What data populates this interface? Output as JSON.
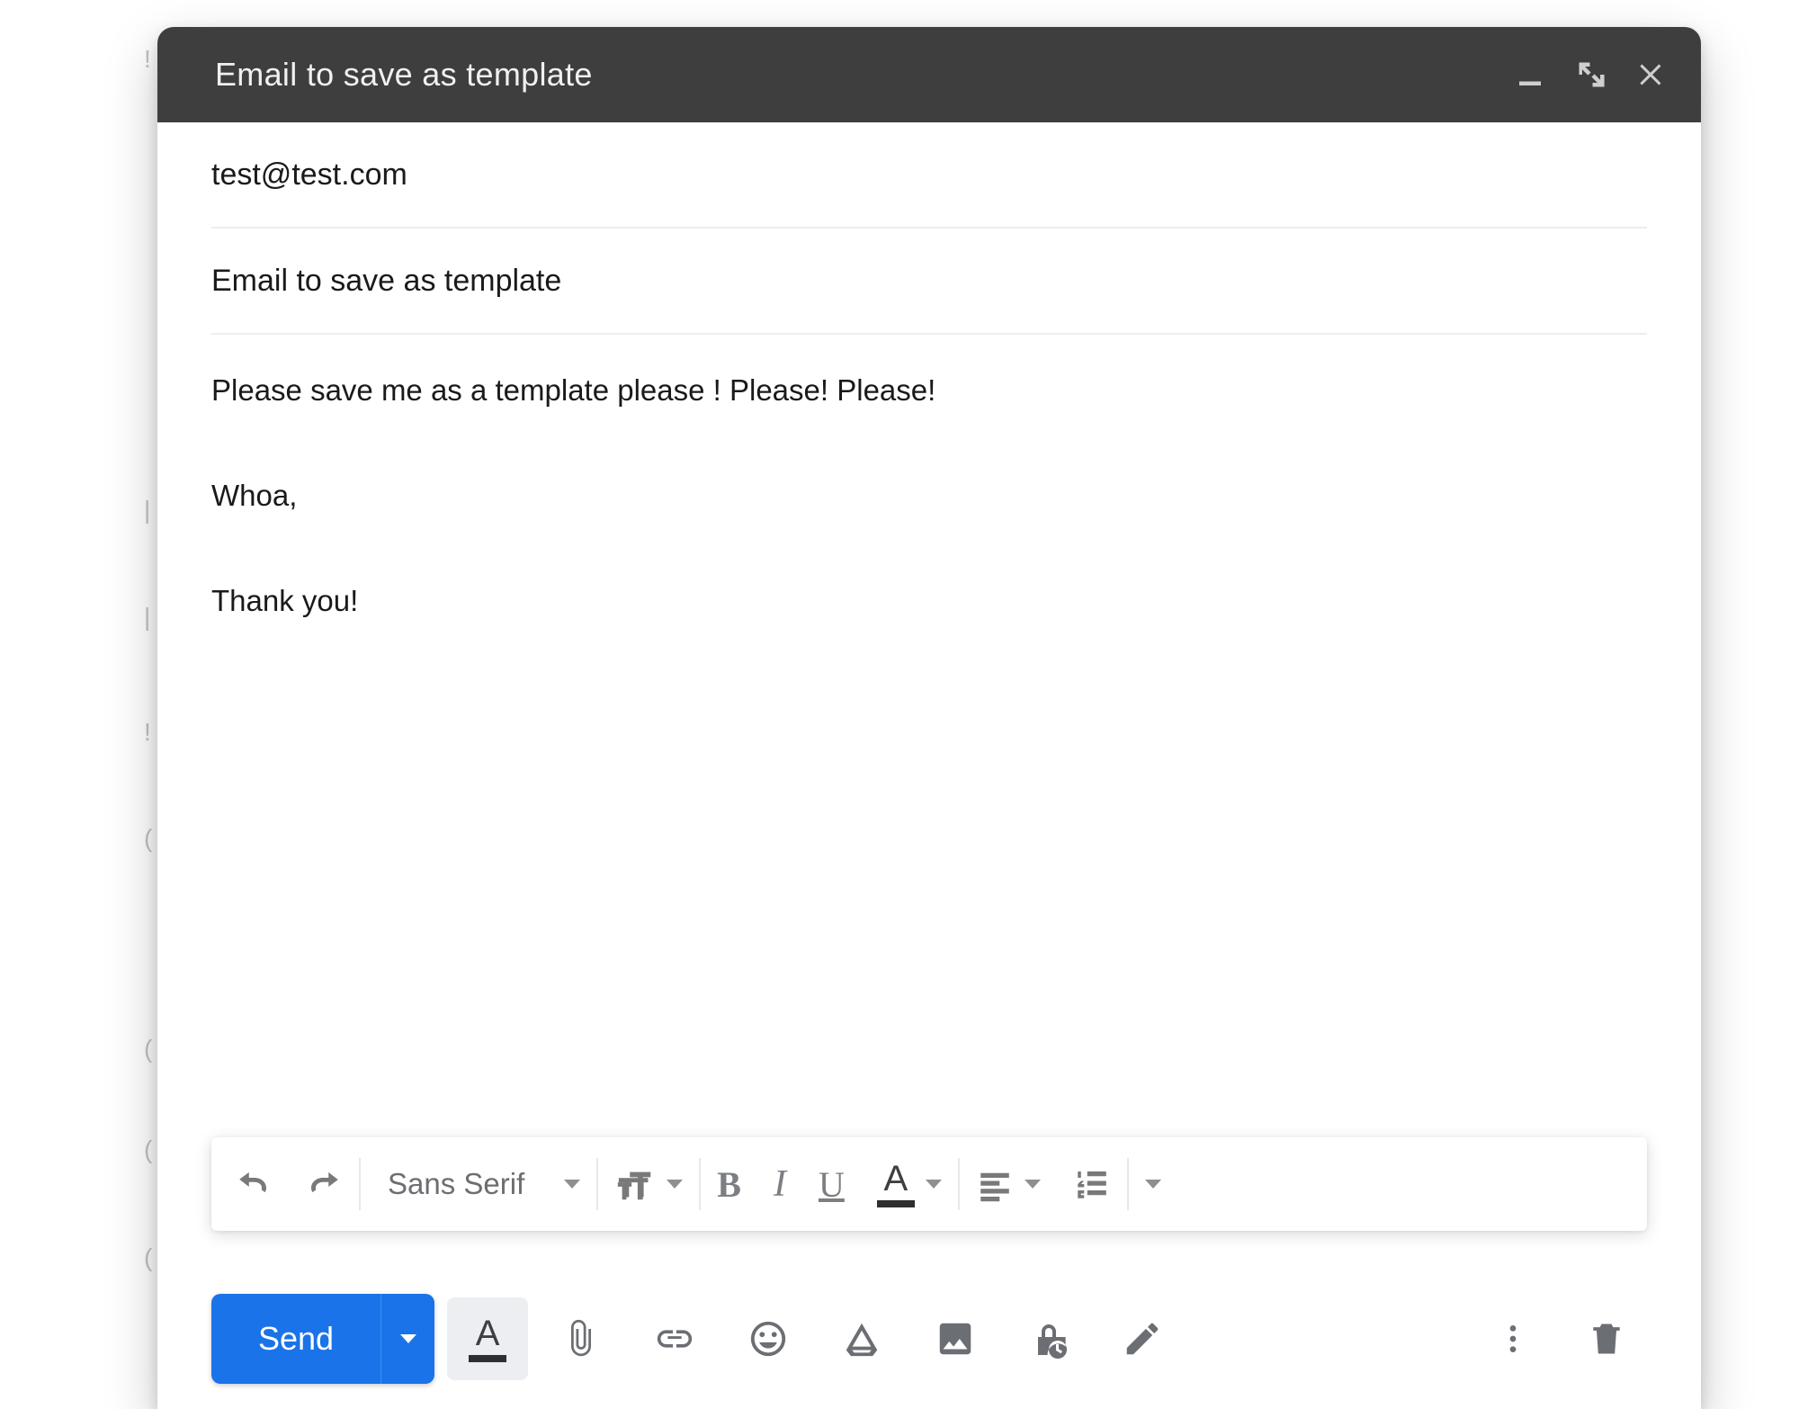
{
  "header": {
    "title": "Email to save as template"
  },
  "fields": {
    "recipients": "test@test.com",
    "subject": "Email to save as template"
  },
  "body_lines": {
    "line1": "Please save me as a template please ! Please! Please!",
    "line2": "Whoa,",
    "line3": "Thank you!"
  },
  "format_toolbar": {
    "font_family": "Sans Serif"
  },
  "bottom_bar": {
    "send_label": "Send"
  }
}
